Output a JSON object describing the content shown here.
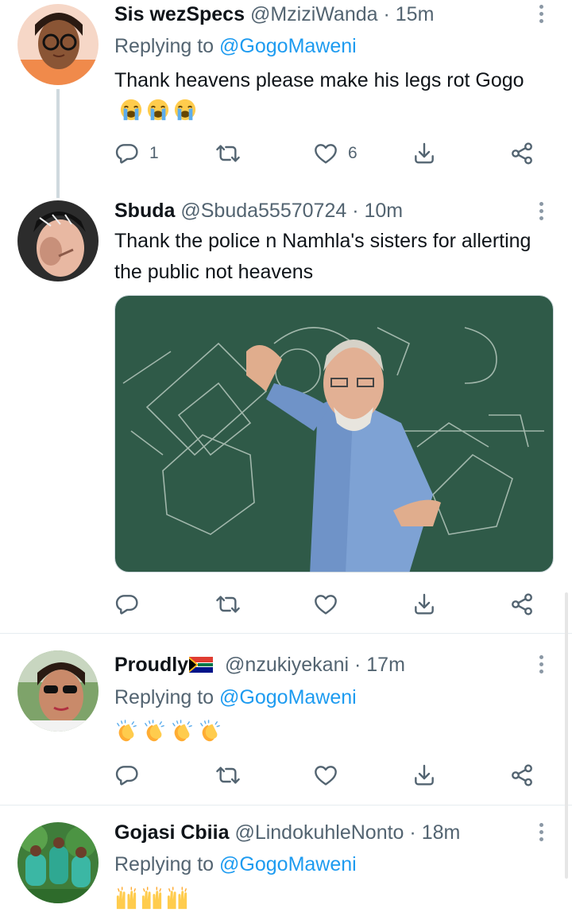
{
  "tweets": [
    {
      "name": "Sis wezSpecs",
      "handle": "@MziziWanda",
      "dot": "·",
      "time": "15m",
      "replying_prefix": "Replying to ",
      "replying_to": "@GogoMaweni",
      "text": "Thank heavens please make his legs rot Gogo",
      "emoji": [
        "loudly-crying-face",
        "loudly-crying-face",
        "loudly-crying-face"
      ],
      "reply_count": "1",
      "retweet_count": "",
      "like_count": "6"
    },
    {
      "name": "Sbuda",
      "handle": "@Sbuda55570724",
      "dot": "·",
      "time": "10m",
      "text": "Thank the police n Namhla's sisters for allerting the public not heavens",
      "media": "photo-professor-at-chalkboard",
      "reply_count": "",
      "retweet_count": "",
      "like_count": ""
    },
    {
      "name": "Proudly",
      "flag": "south-africa-flag",
      "handle": "@nzukiyekani",
      "dot": "·",
      "time": "17m",
      "replying_prefix": "Replying to ",
      "replying_to": "@GogoMaweni",
      "emoji": [
        "clapping-hands",
        "clapping-hands",
        "clapping-hands",
        "clapping-hands"
      ],
      "reply_count": "",
      "retweet_count": "",
      "like_count": ""
    },
    {
      "name": "Gojasi Cbiia",
      "handle": "@LindokuhleNonto",
      "dot": "·",
      "time": "18m",
      "replying_prefix": "Replying to ",
      "replying_to": "@GogoMaweni",
      "emoji": [
        "raising-hands",
        "raising-hands",
        "raising-hands"
      ]
    }
  ],
  "icons": {
    "reply": "reply-icon",
    "retweet": "retweet-icon",
    "like": "like-icon",
    "bookmark": "bookmark-icon",
    "share": "share-icon",
    "more": "more-vertical-icon"
  },
  "colors": {
    "link": "#1d9bf0",
    "secondary_text": "#536471",
    "icon": "#536471"
  }
}
